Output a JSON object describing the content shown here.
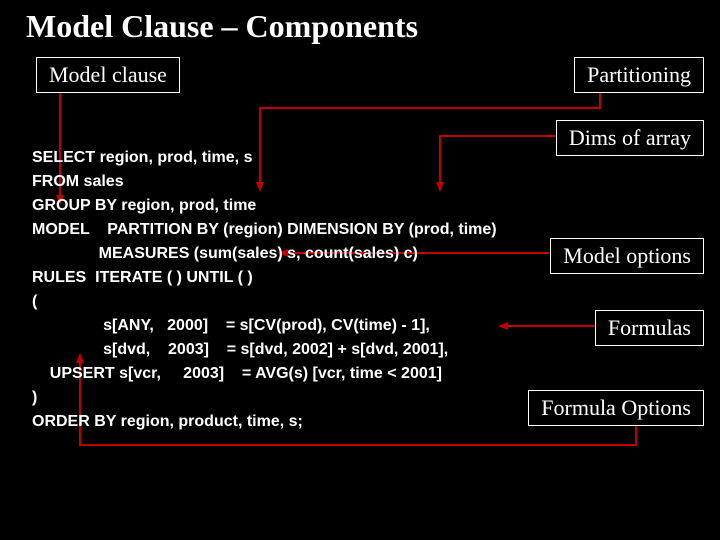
{
  "title": "Model Clause – Components",
  "labels": {
    "model_clause": "Model clause",
    "partitioning": "Partitioning",
    "dims": "Dims of array",
    "model_options": "Model options",
    "formulas": "Formulas",
    "formula_options": "Formula Options"
  },
  "code": {
    "l1": "SELECT region, prod, time, s",
    "l2": "FROM sales",
    "l3": "GROUP BY region, prod, time",
    "l4": "MODEL    PARTITION BY (region) DIMENSION BY (prod, time)",
    "l5": "               MEASURES (sum(sales) s, count(sales) c)",
    "l6": "RULES  ITERATE ( ) UNTIL ( )",
    "l7": "(",
    "l8": "                s[ANY,   2000]    = s[CV(prod), CV(time) - 1],",
    "l9": "                s[dvd,    2003]    = s[dvd, 2002] + s[dvd, 2001],",
    "l10": "    UPSERT s[vcr,     2003]    = AVG(s) [vcr, time < 2001]",
    "l11": ")",
    "l12": "ORDER BY region, product, time, s;"
  },
  "colors": {
    "arrow": "#C00000"
  }
}
